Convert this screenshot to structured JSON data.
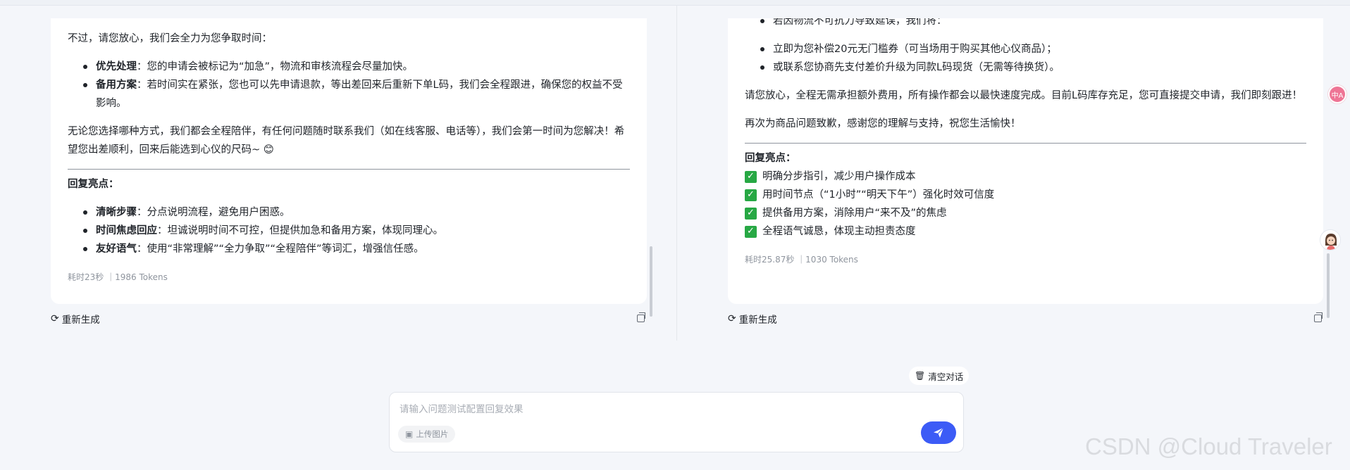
{
  "left_panel": {
    "intro": "不过，请您放心，我们会全力为您争取时间：",
    "bullets": [
      {
        "bold": "优先处理",
        "text": "：您的申请会被标记为“加急”，物流和审核流程会尽量加快。"
      },
      {
        "bold": "备用方案",
        "text": "：若时间实在紧张，您也可以先申请退款，等出差回来后重新下单L码，我们会全程跟进，确保您的权益不受影响。"
      }
    ],
    "closing": "无论您选择哪种方式，我们都会全程陪伴，有任何问题随时联系我们（如在线客服、电话等），我们会第一时间为您解决！希望您出差顺利，回来后能选到心仪的尺码~ 😊",
    "highlights_title": "回复亮点：",
    "highlights": [
      {
        "bold": "清晰步骤",
        "text": "：分点说明流程，避免用户困惑。"
      },
      {
        "bold": "时间焦虑回应",
        "text": "：坦诚说明时间不可控，但提供加急和备用方案，体现同理心。"
      },
      {
        "bold": "友好语气",
        "text": "：使用“非常理解”“全力争取”“全程陪伴”等词汇，增强信任感。"
      }
    ],
    "meta": "耗时23秒 ｜1986 Tokens",
    "regenerate_label": "重新生成"
  },
  "right_panel": {
    "cut_line": "若因物流不可抗力导致延误，我们将：",
    "bullets": [
      "立即为您补偿20元无门槛券（可当场用于购买其他心仪商品）；",
      "或联系您协商先支付差价升级为同款L码现货（无需等待换货）。"
    ],
    "para1": "请您放心，全程无需承担额外费用，所有操作都会以最快速度完成。目前L码库存充足，您可直接提交申请，我们即刻跟进！",
    "para2": "再次为商品问题致歉，感谢您的理解与支持，祝您生活愉快！",
    "highlights_title": "回复亮点：",
    "checks": [
      "明确分步指引，减少用户操作成本",
      "用时间节点（“1小时”“明天下午”）强化时效可信度",
      "提供备用方案，消除用户“来不及”的焦虑",
      "全程语气诚恳，体现主动担责态度"
    ],
    "meta": "耗时25.87秒 ｜1030 Tokens",
    "regenerate_label": "重新生成"
  },
  "clear_button_label": "清空对话",
  "input": {
    "placeholder": "请输入问题测试配置回复效果",
    "upload_label": "上传图片"
  },
  "floating": {
    "translate_label": "中A"
  },
  "watermark": "CSDN @Cloud Traveler",
  "colors": {
    "send_button": "#3c5bf6",
    "check_green": "#27a844",
    "background": "#f4f6fa"
  },
  "icons": {
    "regenerate": "refresh-icon",
    "copy": "copy-icon",
    "clear": "trash-icon",
    "upload": "image-icon",
    "send": "paper-plane-icon"
  }
}
